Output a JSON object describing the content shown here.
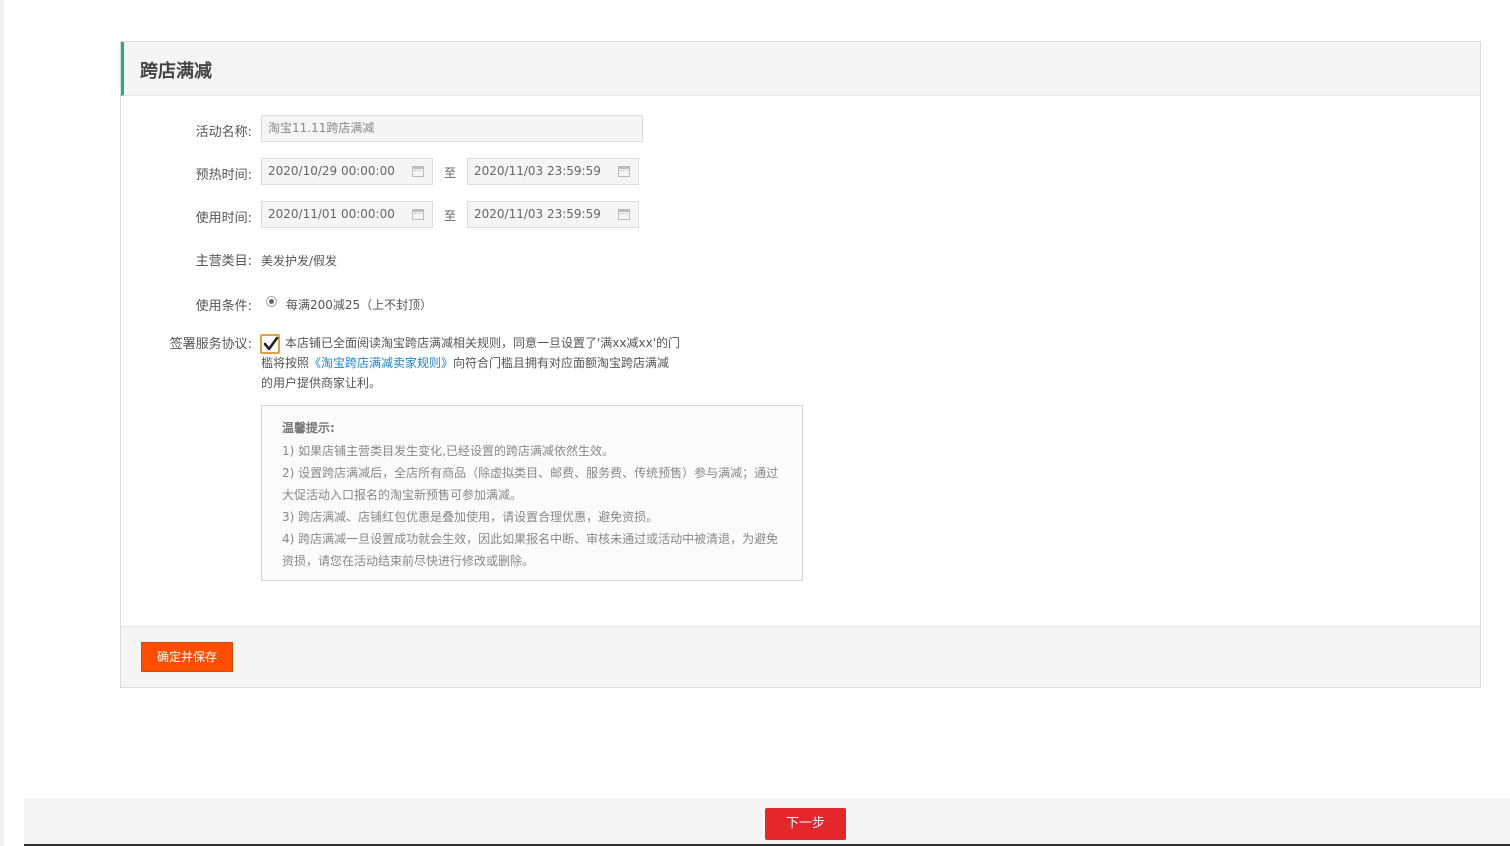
{
  "panel": {
    "title": "跨店满减",
    "accent_color": "#1fb07c"
  },
  "form": {
    "name_label": "活动名称:",
    "name_value": "淘宝11.11跨店满减",
    "preheat_label": "预热时间:",
    "preheat_start": "2020/10/29 00:00:00",
    "preheat_end": "2020/11/03 23:59:59",
    "use_time_label": "使用时间:",
    "use_start": "2020/11/01 00:00:00",
    "use_end": "2020/11/03 23:59:59",
    "to_text": "至",
    "category_label": "主营类目:",
    "category_value": "美发护发/假发",
    "condition_label": "使用条件:",
    "condition_option": "每满200减25（上不封顶）",
    "agreement_label": "签署服务协议:",
    "agreement_text_1": "本店铺已全面阅读淘宝跨店满减相关规则，同意一旦设置了'满xx减xx'的门槛将按照",
    "agreement_link": "《淘宝跨店满减卖家规则》",
    "agreement_text_2": "向符合门槛且拥有对应面额淘宝跨店满减的用户提供商家让利。"
  },
  "tips": {
    "title": "温馨提示:",
    "lines": [
      "1) 如果店铺主营类目发生变化,已经设置的跨店满减依然生效。",
      "2) 设置跨店满减后，全店所有商品（除虚拟类目、邮费、服务费、传统预售）参与满减；通过大促活动入口报名的淘宝新预售可参加满减。",
      "3) 跨店满减、店铺红包优惠是叠加使用，请设置合理优惠，避免资损。",
      "4) 跨店满减一旦设置成功就会生效，因此如果报名中断、审核未通过或活动中被清退，为避免资损，请您在活动结束前尽快进行修改或删除。"
    ]
  },
  "actions": {
    "save_label": "确定并保存",
    "save_color": "#ff4e00",
    "next_label": "下一步",
    "next_color": "#e5262b"
  }
}
